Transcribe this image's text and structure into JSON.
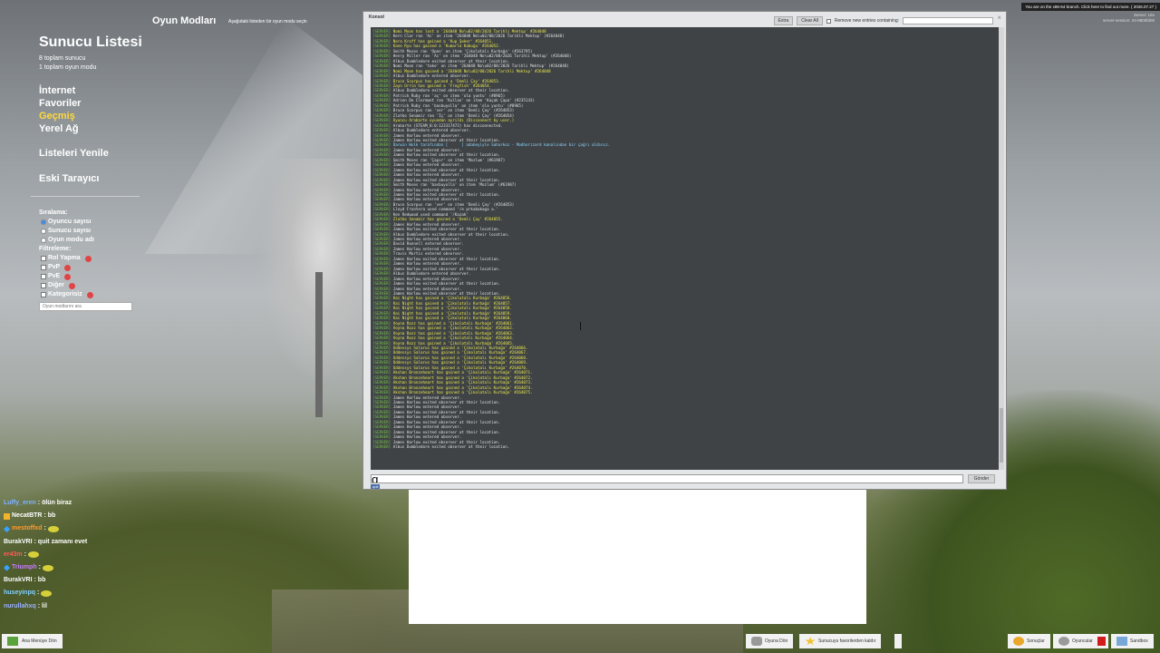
{
  "header": {
    "game_modes": "Oyun Modları",
    "game_modes_sub": "Aşağıdaki listeden bir oyun modu seçin"
  },
  "server_list": {
    "title": "Sunucu Listesi",
    "stats": [
      "8 toplam sunucu",
      "1 toplam oyun modu"
    ],
    "nav": [
      {
        "label": "İnternet",
        "active": false
      },
      {
        "label": "Favoriler",
        "active": false
      },
      {
        "label": "Geçmiş",
        "active": true
      },
      {
        "label": "Yerel Ağ",
        "active": false
      }
    ],
    "refresh": "Listeleri Yenile",
    "legacy": "Eski Tarayıcı",
    "sort_label": "Sıralama:",
    "sort_options": [
      "Oyuncu sayısı",
      "Sunucu sayısı",
      "Oyun modu adı"
    ],
    "filters_label": "Filtreleme:",
    "filters": [
      "Rol Yapma",
      "PvP",
      "PvE",
      "Diğer",
      "Kategorisiz"
    ],
    "search_placeholder": "Oyun modlarını ara"
  },
  "console": {
    "title": "Konsol",
    "extra_btn": "Extra",
    "clear_btn": "Clear All",
    "remove_label": "Remove new entries containing:",
    "send_btn": "Gönder",
    "input_value": "q",
    "autocomplete": "quit",
    "lines": [
      {
        "t": "Nomi Moon has lost a '264048 No\\u02/08/2026 Tarihli Mektup' #264048",
        "k": "gain"
      },
      {
        "t": "Kern Clar ran 'Ac' on item '264048 No\\u02/08/2026 Tarihli Mektup' (#264048)",
        "k": "n"
      },
      {
        "t": "Nora Kroff has gained a 'Kup Şeker' #264051.",
        "k": "gain"
      },
      {
        "t": "Kane Ryu has gained a 'Kumarla Kabuğu' #264052.",
        "k": "gain"
      },
      {
        "t": "Smith Moses ran 'Open' on item 'Çikolatalı Kurbağa' (#263795)",
        "k": "n"
      },
      {
        "t": "Henry Miller ran 'Ac' on item '264048 No\\u02/08/2026 Tarihli Mektup' (#264048)",
        "k": "n"
      },
      {
        "t": "Albus Dumbledore exited observer at their location.",
        "k": "n"
      },
      {
        "t": "Nomi Moon ran 'take' on item '264048 No\\u02/08/2026 Tarihli Mektup' (#264048)",
        "k": "n"
      },
      {
        "t": "Nomi Moon has gained a '264048 No\\u02/08/2026 Tarihli Mektup' #264048",
        "k": "gain"
      },
      {
        "t": "Albus Dumbledore entered observer.",
        "k": "n"
      },
      {
        "t": "Bruce Scorpus has gained a 'Demli Çay' #264053.",
        "k": "gain"
      },
      {
        "t": "Zayn Orrin has gained a 'Frogfish' #264054.",
        "k": "gain"
      },
      {
        "t": "Albus Dumbledore exited observer at their location.",
        "k": "n"
      },
      {
        "t": "Patrick Ruby ran 'aç' on item 'ola yuntu' (#8965)",
        "k": "n"
      },
      {
        "t": "Adrien De Clermont ran 'Kullan' on item 'Kaçak Çapa' (#235143)",
        "k": "n"
      },
      {
        "t": "Patrick Ruby ran 'basbuyolla' on item 'ola yuntu' (#8965)",
        "k": "n"
      },
      {
        "t": "Bruce Scorpus ran 'ver' on item 'Demli Çay' (#264053)",
        "k": "n"
      },
      {
        "t": "Zlatko Senamir ran 'İç' on item 'Demli Çay' (#264054)",
        "k": "n"
      },
      {
        "t": "Oyuncu Arabarte oyundan ayrıldı (Disconnect by user.)",
        "k": "gain"
      },
      {
        "t": "Arabarte (STEAM_0:0:123317473) has disconnected.",
        "k": "n"
      },
      {
        "t": "Albus Dumbledore entered observer.",
        "k": "n"
      },
      {
        "t": "James Harlow entered observer.",
        "k": "n"
      },
      {
        "t": "James Harlow exited observer at their location.",
        "k": "n"
      },
      {
        "t": "Darwin Wolk tarafından [      ] adabeyiyle Saharkoz - Modhorizard kanalından bir çağrı aldınız.",
        "k": "cyan"
      },
      {
        "t": "James Harlow entered observer.",
        "k": "n"
      },
      {
        "t": "James Harlow exited observer at their location.",
        "k": "n"
      },
      {
        "t": "Smith Moses ran 'Çapır' on item 'Mozlum' (#61907)",
        "k": "n"
      },
      {
        "t": "James Harlow entered observer.",
        "k": "n"
      },
      {
        "t": "James Harlow exited observer at their location.",
        "k": "n"
      },
      {
        "t": "James Harlow entered observer.",
        "k": "n"
      },
      {
        "t": "James Harlow exited observer at their location.",
        "k": "n"
      },
      {
        "t": "Smith Moses ran 'basbuyolla' on item 'Mozlum' (#61907)",
        "k": "n"
      },
      {
        "t": "James Harlow entered observer.",
        "k": "n"
      },
      {
        "t": "James Harlow exited observer at their location.",
        "k": "n"
      },
      {
        "t": "James Harlow entered observer.",
        "k": "n"
      },
      {
        "t": "Bruce Scorpus ran 'ver' on item 'Demli Çay' (#264053)",
        "k": "n"
      },
      {
        "t": "Lloyd Frontera used command '/e prkabakaga a.'",
        "k": "n"
      },
      {
        "t": "Ken Redwood used command '/Kazak'",
        "k": "n"
      },
      {
        "t": "Zlatko Senamir has gained a 'Demli Çay' #264055.",
        "k": "gain"
      },
      {
        "t": "James Harlow entered observer.",
        "k": "n"
      },
      {
        "t": "James Harlow exited observer at their location.",
        "k": "n"
      },
      {
        "t": "Albus Dumbledore exited observer at their location.",
        "k": "n"
      },
      {
        "t": "James Harlow entered observer.",
        "k": "n"
      },
      {
        "t": "David Ronnell entered observer.",
        "k": "n"
      },
      {
        "t": "James Harlow entered observer.",
        "k": "n"
      },
      {
        "t": "Travis Mortis entered observer.",
        "k": "n"
      },
      {
        "t": "James Harlow exited observer at their location.",
        "k": "n"
      },
      {
        "t": "James Harlow entered observer.",
        "k": "n"
      },
      {
        "t": "James Harlow exited observer at their location.",
        "k": "n"
      },
      {
        "t": "Albus Dumbledore entered observer.",
        "k": "n"
      },
      {
        "t": "James Harlow entered observer.",
        "k": "n"
      },
      {
        "t": "James Harlow exited observer at their location.",
        "k": "n"
      },
      {
        "t": "James Harlow entered observer.",
        "k": "n"
      },
      {
        "t": "James Harlow exited observer at their location.",
        "k": "n"
      },
      {
        "t": "Kai Night has gained a 'Çikolatalı Kurbağa' #264056.",
        "k": "gain"
      },
      {
        "t": "Kai Night has gained a 'Çikolatalı Kurbağa' #264057.",
        "k": "gain"
      },
      {
        "t": "Kai Night has gained a 'Çikolatalı Kurbağa' #264058.",
        "k": "gain"
      },
      {
        "t": "Kai Night has gained a 'Çikolatalı Kurbağa' #264059.",
        "k": "gain"
      },
      {
        "t": "Kai Night has gained a 'Çikolatalı Kurbağa' #264060.",
        "k": "gain"
      },
      {
        "t": "Voyna Rozz has gained a 'Çikolatalı Kurbağa' #264061.",
        "k": "gain"
      },
      {
        "t": "Voyna Rozz has gained a 'Çikolatalı Kurbağa' #264062.",
        "k": "gain"
      },
      {
        "t": "Voyna Rozz has gained a 'Çikolatalı Kurbağa' #264063.",
        "k": "gain"
      },
      {
        "t": "Voyna Rozz has gained a 'Çikolatalı Kurbağa' #264064.",
        "k": "gain"
      },
      {
        "t": "Voyna Rozz has gained a 'Çikolatalı Kurbağa' #264065.",
        "k": "gain"
      },
      {
        "t": "Oddessys Salarus has gained a 'Çikolatalı Kurbağa' #264066.",
        "k": "gain"
      },
      {
        "t": "Oddessys Salarus has gained a 'Çikolatalı Kurbağa' #264067.",
        "k": "gain"
      },
      {
        "t": "Oddessys Salarus has gained a 'Çikolatalı Kurbağa' #264068.",
        "k": "gain"
      },
      {
        "t": "Oddessys Salarus has gained a 'Çikolatalı Kurbağa' #264069.",
        "k": "gain"
      },
      {
        "t": "Oddessys Salarus has gained a 'Çikolatalı Kurbağa' #264070.",
        "k": "gain"
      },
      {
        "t": "Akshan Bronzeheart has gained a 'Çikolatalı Kurbağa' #264071.",
        "k": "gain"
      },
      {
        "t": "Akshan Bronzeheart has gained a 'Çikolatalı Kurbağa' #264072.",
        "k": "gain"
      },
      {
        "t": "Akshan Bronzeheart has gained a 'Çikolatalı Kurbağa' #264073.",
        "k": "gain"
      },
      {
        "t": "Akshan Bronzeheart has gained a 'Çikolatalı Kurbağa' #264074.",
        "k": "gain"
      },
      {
        "t": "Akshan Bronzeheart has gained a 'Çikolatalı Kurbağa' #264075.",
        "k": "gain"
      },
      {
        "t": "James Harlow entered observer.",
        "k": "n"
      },
      {
        "t": "James Harlow exited observer at their location.",
        "k": "n"
      },
      {
        "t": "James Harlow entered observer.",
        "k": "n"
      },
      {
        "t": "James Harlow exited observer at their location.",
        "k": "n"
      },
      {
        "t": "James Harlow entered observer.",
        "k": "n"
      },
      {
        "t": "James Harlow exited observer at their location.",
        "k": "n"
      },
      {
        "t": "James Harlow entered observer.",
        "k": "n"
      },
      {
        "t": "James Harlow exited observer at their location.",
        "k": "n"
      },
      {
        "t": "James Harlow entered observer.",
        "k": "n"
      },
      {
        "t": "James Harlow exited observer at their location.",
        "k": "n"
      },
      {
        "t": "Albus Dumbledore exited observer at their location.",
        "k": "n"
      }
    ]
  },
  "top_right": {
    "branch_notice": "You are on the x86-64 branch. Click here to find out more. ( 2026.07.27 )",
    "version_lines": [
      "Server: Lite",
      "server-session: 24-8800fd00"
    ]
  },
  "chat": [
    {
      "name": "Luffy_eren",
      "text": " : ölün biraz",
      "color": "#7fb2ff",
      "icon": "none"
    },
    {
      "name": "NecatBTR",
      "text": " : bb",
      "color": "#ffffff",
      "icon": "shield"
    },
    {
      "name": "mestoffxd",
      "text": " : ",
      "color": "#ff9b2e",
      "icon": "diamond",
      "emote": true
    },
    {
      "name": "BurakVRI",
      "text": " : quit zamanı evet",
      "color": "#ffffff",
      "icon": "none"
    },
    {
      "name": "er43m",
      "text": " : ",
      "color": "#ff5a5a",
      "icon": "none",
      "emote": true
    },
    {
      "name": "Triumph",
      "text": " : ",
      "color": "#c77bff",
      "icon": "diamond",
      "emote": true
    },
    {
      "name": "BurakVRI",
      "text": " : bb",
      "color": "#ffffff",
      "icon": "none"
    },
    {
      "name": "huseyinpq",
      "text": " : ",
      "color": "#7fd0ff",
      "icon": "none",
      "emote": true
    },
    {
      "name": "nurullahxq",
      "text": " : lil",
      "color": "#9ab0ff",
      "icon": "none"
    }
  ],
  "bottom_bar": {
    "main_menu": "Ana Menüye Dön",
    "return_game": "Oyuna Dön",
    "add_favorite": "Sunucuyu favorilerden kaldır",
    "settings": "Sonuçlar",
    "players": "Oyuncular",
    "sandbox": "Sandbox"
  }
}
